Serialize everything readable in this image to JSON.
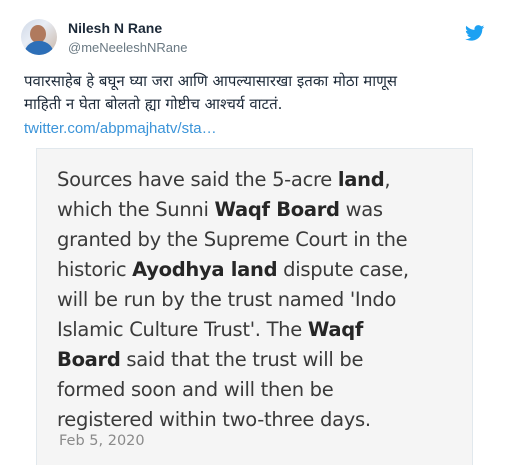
{
  "author": {
    "name": "Nilesh N Rane",
    "handle": "@meNeeleshNRane"
  },
  "tweet": {
    "text_line1": "पवारसाहेब हे बघून घ्या जरा आणि आपल्यासारखा इतका मोठा माणूस",
    "text_line2": "माहिती न घेता बोलतो ह्या गोष्टीच आश्चर्य वाटतं.",
    "link": "twitter.com/abpmajhatv/sta…"
  },
  "media": {
    "line1_a": "Sources have said the 5-acre ",
    "line1_b": "land",
    "line1_c": ",",
    "line2_a": "which the Sunni ",
    "line2_b": "Waqf Board",
    "line2_c": " was",
    "line3": "granted by the Supreme Court in the",
    "line4_a": "historic ",
    "line4_b": "Ayodhya land",
    "line4_c": " dispute case,",
    "line5": "will be run by the trust named 'Indo",
    "line6_a": "Islamic Culture Trust'. The ",
    "line6_b": "Waqf",
    "line7_a": "Board",
    "line7_b": " said that the trust will be",
    "line8": "formed soon and will then be",
    "line9": "registered within two-three days.",
    "date": "Feb 5, 2020"
  },
  "icons": {
    "brand": "twitter-bird-icon",
    "brand_color": "#1da1f2"
  },
  "colors": {
    "link": "#3b94d9",
    "text": "#1c2938",
    "muted": "#697882"
  }
}
